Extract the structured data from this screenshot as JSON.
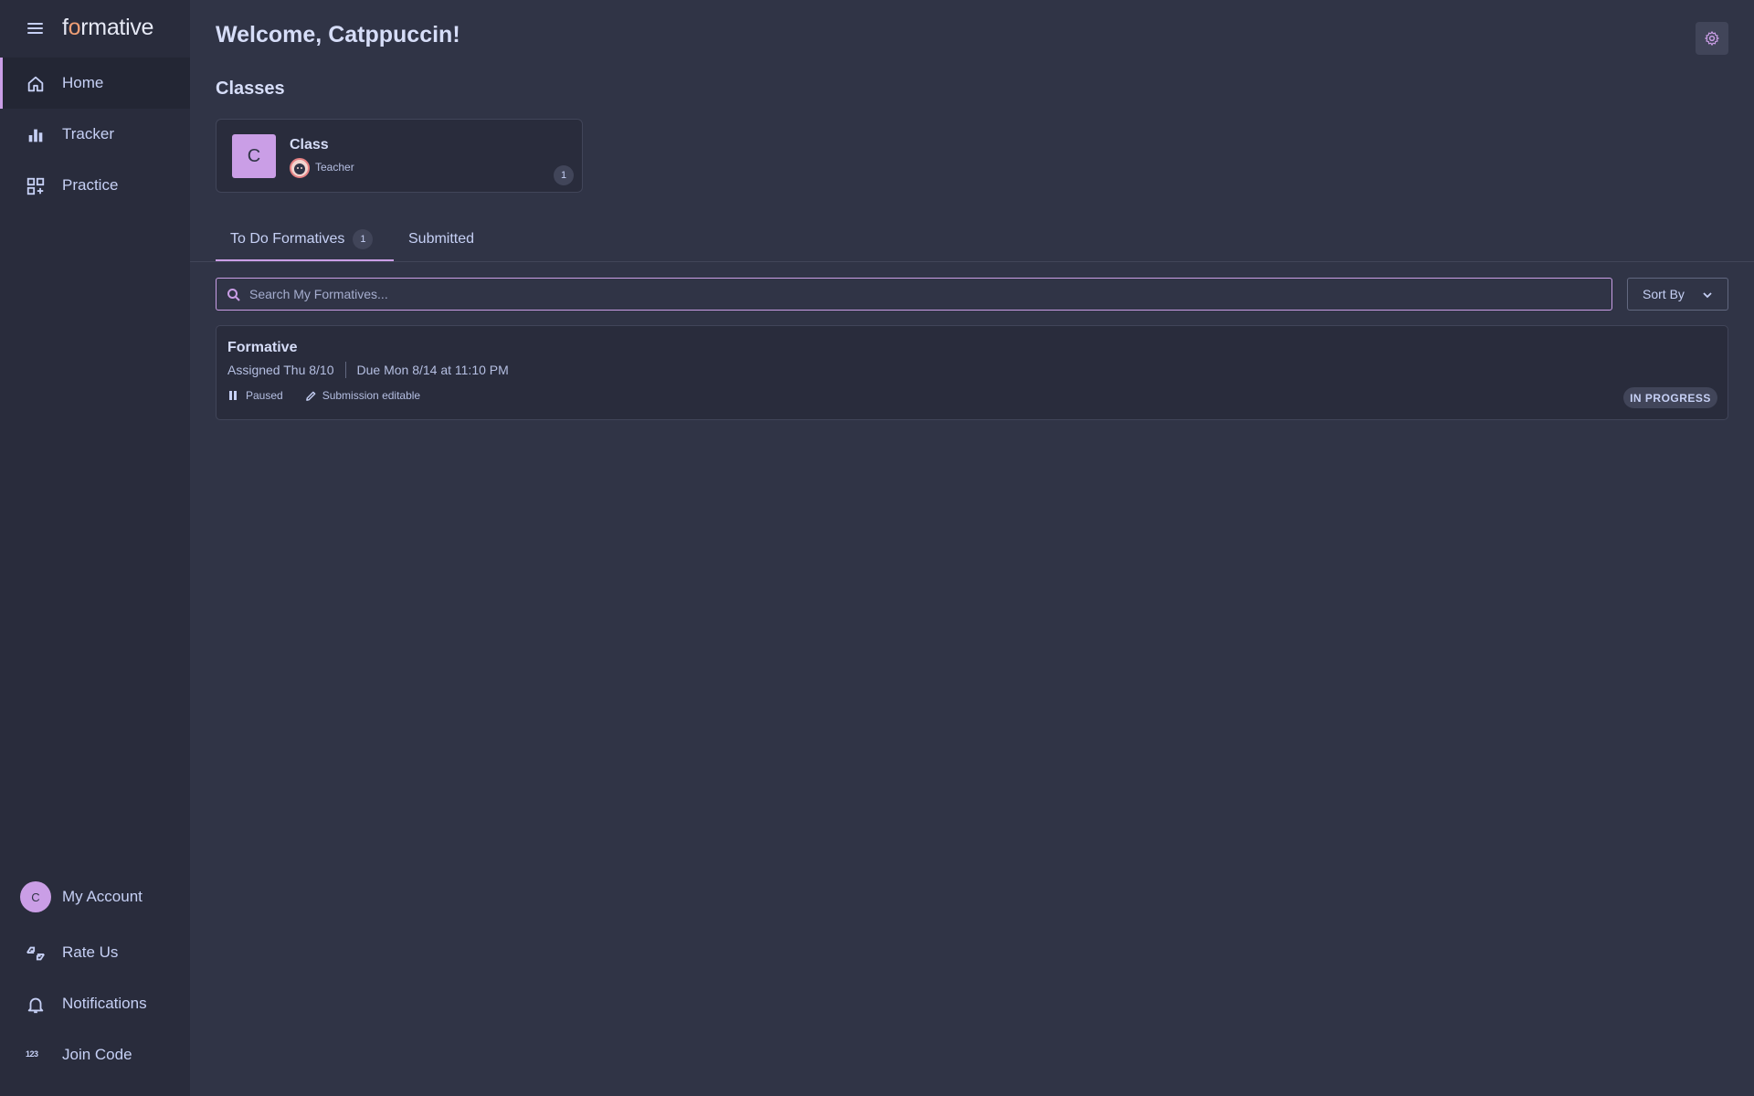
{
  "brand": {
    "logo_text_pre": "f",
    "logo_text_o": "o",
    "logo_text_post": "rmative"
  },
  "sidebar": {
    "top_items": [
      {
        "label": "Home",
        "icon": "home-icon",
        "active": true
      },
      {
        "label": "Tracker",
        "icon": "bar-chart-icon",
        "active": false
      },
      {
        "label": "Practice",
        "icon": "practice-grid-icon",
        "active": false
      }
    ],
    "bottom_items": [
      {
        "label": "My Account",
        "icon": "avatar",
        "avatar_letter": "C"
      },
      {
        "label": "Rate Us",
        "icon": "rate-us-icon"
      },
      {
        "label": "Notifications",
        "icon": "bell-icon"
      },
      {
        "label": "Join Code",
        "icon": "join-code-icon",
        "icon_text": "123"
      }
    ]
  },
  "header": {
    "welcome": "Welcome, Catppuccin!",
    "settings_icon": "gear-icon"
  },
  "classes": {
    "title": "Classes",
    "items": [
      {
        "avatar_letter": "C",
        "name": "Class",
        "teacher_label": "Teacher",
        "count": "1"
      }
    ]
  },
  "tabs": {
    "todo": {
      "label": "To Do Formatives",
      "count": "1"
    },
    "submitted": {
      "label": "Submitted"
    }
  },
  "search": {
    "placeholder": "Search My Formatives...",
    "value": ""
  },
  "sort": {
    "label": "Sort By"
  },
  "formatives": [
    {
      "title": "Formative",
      "assigned": "Assigned Thu 8/10",
      "due": "Due Mon 8/14 at 11:10 PM",
      "state": "Paused",
      "editable": "Submission editable",
      "status_badge": "IN PROGRESS"
    }
  ],
  "colors": {
    "background": "#303446",
    "sidebar": "#292c3c",
    "accent": "#ca9ee6",
    "text": "#c6d0f5",
    "surface": "#414559"
  }
}
